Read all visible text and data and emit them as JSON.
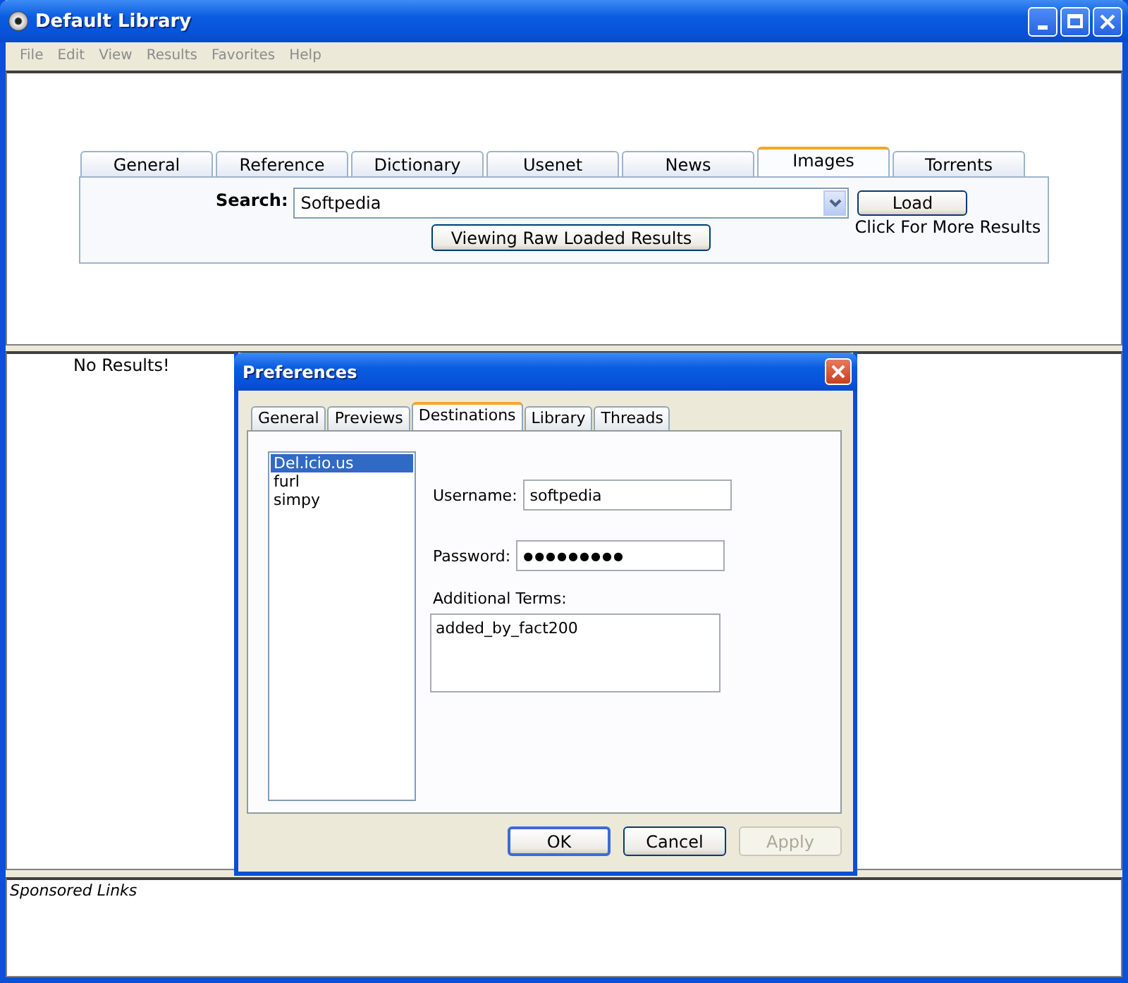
{
  "window": {
    "title": "Default Library"
  },
  "menu": [
    "File",
    "Edit",
    "View",
    "Results",
    "Favorites",
    "Help"
  ],
  "tabs": [
    {
      "label": "General",
      "selected": false
    },
    {
      "label": "Reference",
      "selected": false
    },
    {
      "label": "Dictionary",
      "selected": false
    },
    {
      "label": "Usenet",
      "selected": false
    },
    {
      "label": "News",
      "selected": false
    },
    {
      "label": "Images",
      "selected": true
    },
    {
      "label": "Torrents",
      "selected": false
    }
  ],
  "search": {
    "label": "Search:",
    "value": "Softpedia",
    "load_button": "Load",
    "load_hint": "Click For More Results",
    "view_button": "Viewing Raw Loaded Results"
  },
  "results": {
    "message": "No Results!"
  },
  "dialog": {
    "title": "Preferences",
    "tabs": [
      {
        "label": "General",
        "selected": false
      },
      {
        "label": "Previews",
        "selected": false
      },
      {
        "label": "Destinations",
        "selected": true
      },
      {
        "label": "Library",
        "selected": false
      },
      {
        "label": "Threads",
        "selected": false
      }
    ],
    "destinations": [
      {
        "label": "Del.icio.us",
        "selected": true
      },
      {
        "label": "furl",
        "selected": false
      },
      {
        "label": "simpy",
        "selected": false
      }
    ],
    "username": {
      "label": "Username:",
      "value": "softpedia"
    },
    "password": {
      "label": "Password:",
      "value": "●●●●●●●●●"
    },
    "terms": {
      "label": "Additional Terms:",
      "value": "added_by_fact200"
    },
    "buttons": [
      {
        "label": "OK",
        "disabled": false
      },
      {
        "label": "Cancel",
        "disabled": false
      },
      {
        "label": "Apply",
        "disabled": true
      }
    ]
  },
  "sponsored": {
    "label": "Sponsored Links"
  }
}
